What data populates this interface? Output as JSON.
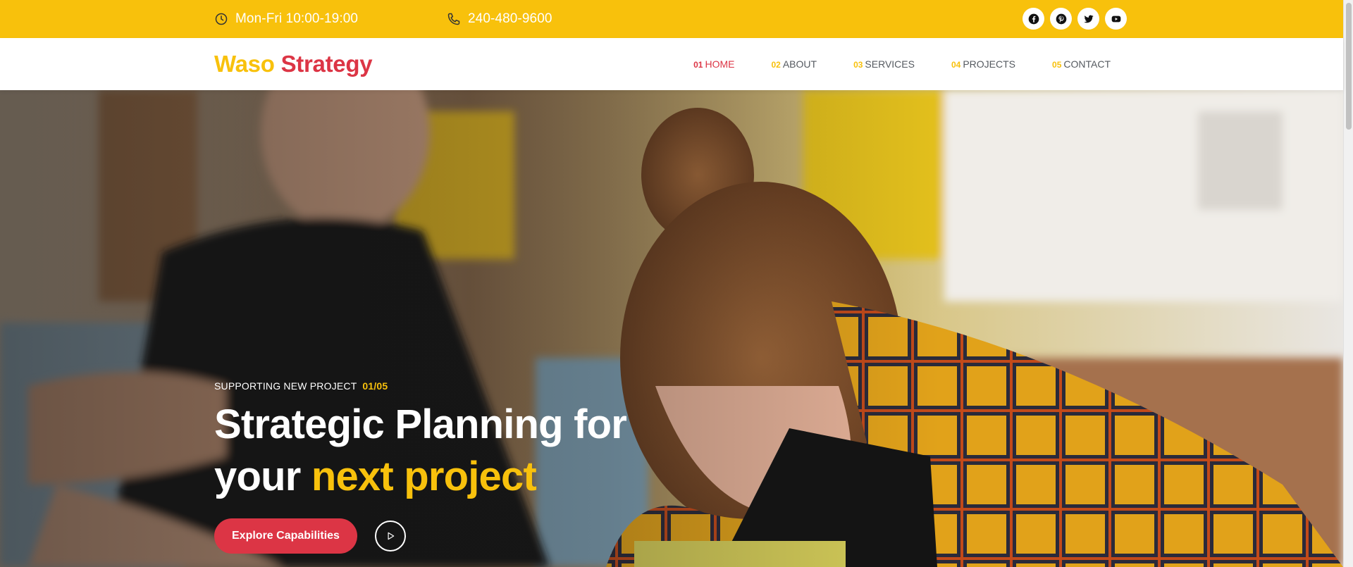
{
  "topbar": {
    "hours": "Mon-Fri 10:00-19:00",
    "phone": "240-480-9600",
    "hours_icon": "clock-icon",
    "phone_icon": "phone-icon",
    "socials": [
      "facebook-icon",
      "pinterest-icon",
      "twitter-icon",
      "youtube-icon"
    ]
  },
  "brand": {
    "part1": "Waso",
    "part2": "Strategy"
  },
  "nav": [
    {
      "num": "01",
      "label": "HOME",
      "active": true
    },
    {
      "num": "02",
      "label": "ABOUT"
    },
    {
      "num": "03",
      "label": "SERVICES"
    },
    {
      "num": "04",
      "label": "PROJECTS"
    },
    {
      "num": "05",
      "label": "CONTACT"
    }
  ],
  "hero": {
    "eyebrow": "SUPPORTING NEW PROJECT",
    "slide_count": "01/05",
    "headline_line1": "Strategic Planning for",
    "headline_line2_prefix": "your",
    "headline_highlight": "next project",
    "cta": "Explore Capabilities",
    "play_icon": "play-icon"
  },
  "colors": {
    "accent_yellow": "#f8c10c",
    "accent_red": "#dc3545",
    "nav_text": "#555a60"
  }
}
